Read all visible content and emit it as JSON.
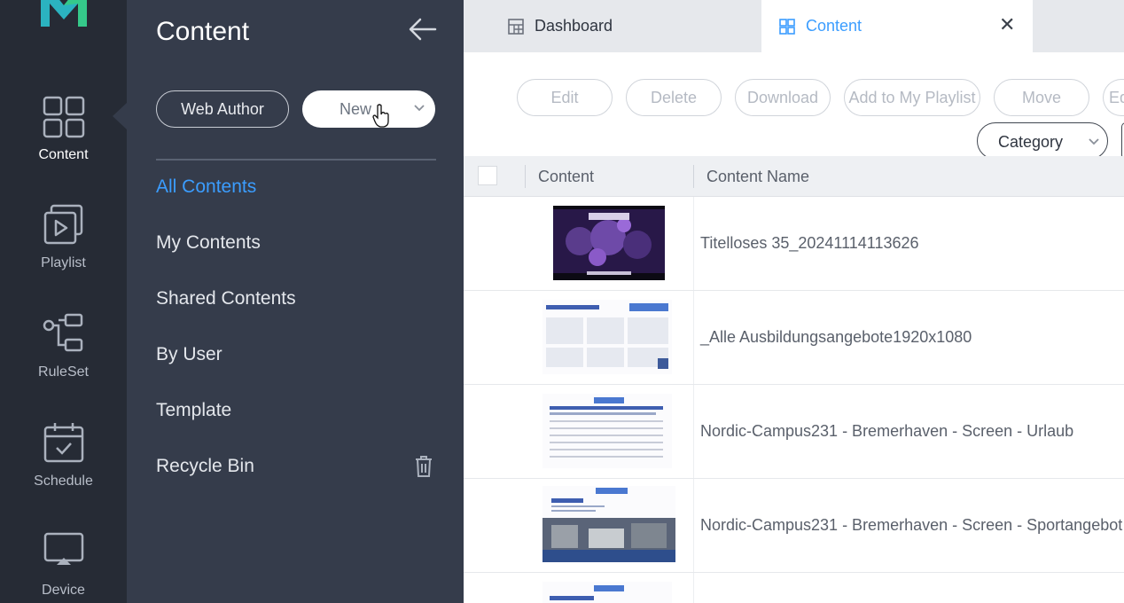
{
  "rail": {
    "items": [
      {
        "label": "Content",
        "icon": "grid-icon"
      },
      {
        "label": "Playlist",
        "icon": "playlist-icon"
      },
      {
        "label": "RuleSet",
        "icon": "ruleset-icon"
      },
      {
        "label": "Schedule",
        "icon": "schedule-icon"
      },
      {
        "label": "Device",
        "icon": "device-icon"
      }
    ]
  },
  "subnav": {
    "title": "Content",
    "web_author_label": "Web Author",
    "new_label": "New",
    "items": [
      {
        "label": "All Contents"
      },
      {
        "label": "My Contents"
      },
      {
        "label": "Shared Contents"
      },
      {
        "label": "By User"
      },
      {
        "label": "Template"
      },
      {
        "label": "Recycle Bin"
      }
    ]
  },
  "tabs": [
    {
      "label": "Dashboard"
    },
    {
      "label": "Content"
    }
  ],
  "toolbar": {
    "buttons": [
      "Edit",
      "Delete",
      "Download",
      "Add to My Playlist",
      "Move",
      "Ed"
    ],
    "category_label": "Category"
  },
  "table": {
    "headers": [
      "Content",
      "Content Name"
    ],
    "rows": [
      {
        "name": "Titelloses 35_20241114113626"
      },
      {
        "name": "_Alle Ausbildungsangebote1920x1080"
      },
      {
        "name": "Nordic-Campus231 - Bremerhaven - Screen - Urlaub"
      },
      {
        "name": "Nordic-Campus231 - Bremerhaven - Screen - Sportangebot"
      },
      {
        "name": ""
      }
    ]
  },
  "colors": {
    "rail_bg": "#262b35",
    "subnav_bg": "#353c4b",
    "accent": "#3b9dff",
    "logo": "#2ec4b6"
  }
}
